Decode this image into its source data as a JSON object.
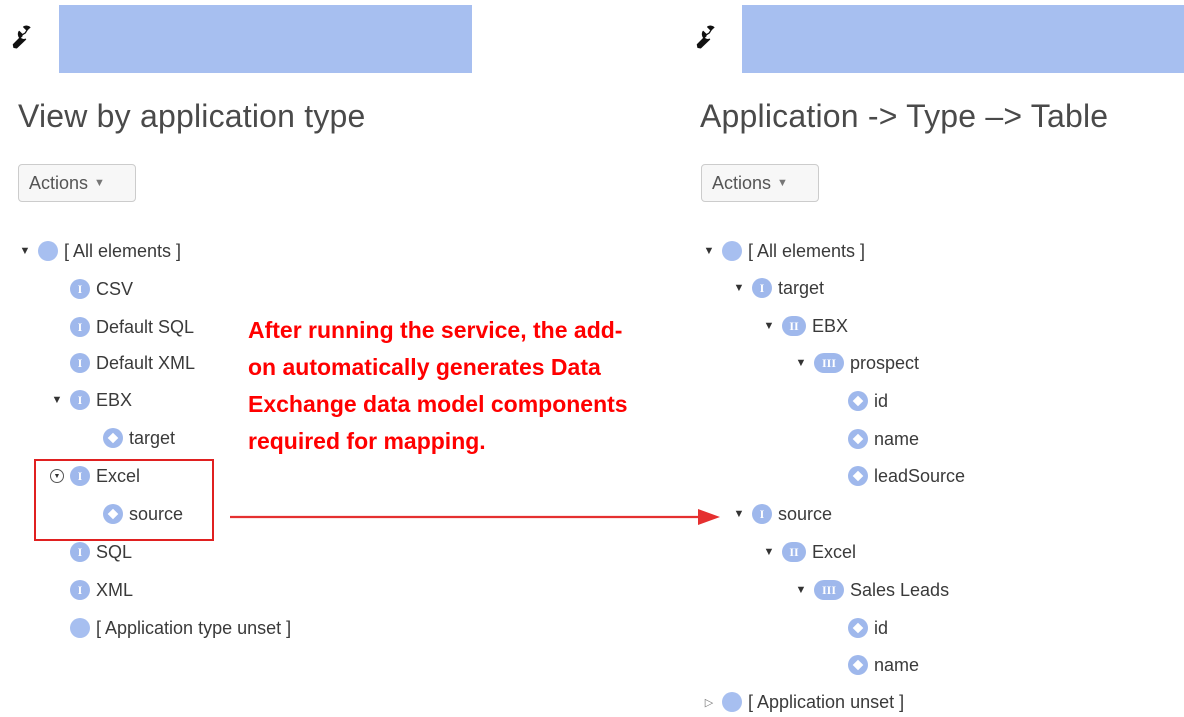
{
  "left_panel": {
    "title": "View by application type",
    "actions_label": "Actions",
    "tree": {
      "root": "[ All elements ]",
      "csv": "CSV",
      "default_sql": "Default SQL",
      "default_xml": "Default XML",
      "ebx": "EBX",
      "ebx_target": "target",
      "excel": "Excel",
      "excel_source": "source",
      "sql": "SQL",
      "xml": "XML",
      "unset": "[ Application type unset ]"
    }
  },
  "right_panel": {
    "title": "Application -> Type –> Table",
    "actions_label": "Actions",
    "tree": {
      "root": "[ All elements ]",
      "target": "target",
      "target_ebx": "EBX",
      "prospect": "prospect",
      "prospect_id": "id",
      "prospect_name": "name",
      "prospect_leadsource": "leadSource",
      "source": "source",
      "source_excel": "Excel",
      "sales_leads": "Sales Leads",
      "sales_leads_id": "id",
      "sales_leads_name": "name",
      "unset": "[ Application unset ]"
    }
  },
  "badges": {
    "level1": "I",
    "level2": "II",
    "level3": "III"
  },
  "annotation": {
    "text": "After running the service, the add-\non automatically generates Data\nExchange data model components\nrequired for mapping.",
    "color": "#ff0000"
  },
  "icons": {
    "toolbar": "wrench-icon",
    "folder": "circle-icon",
    "leaf": "leaf-node-icon"
  },
  "colors": {
    "accent": "#a7bff0",
    "annotation": "#ff0000",
    "text": "#333333"
  }
}
